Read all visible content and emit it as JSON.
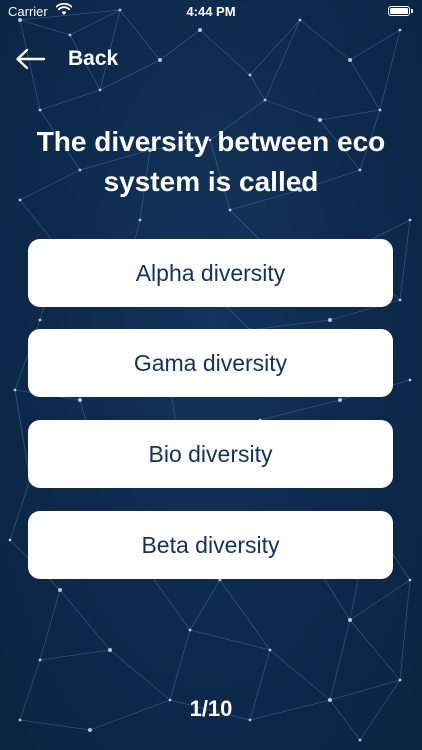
{
  "status_bar": {
    "carrier": "Carrier",
    "time": "4:44 PM",
    "wifi_icon": "wifi-icon",
    "battery_icon": "battery-icon"
  },
  "nav": {
    "back_label": "Back",
    "back_icon": "arrow-left-icon"
  },
  "question": {
    "text": "The diversity between eco system is called"
  },
  "options": [
    {
      "label": "Alpha diversity"
    },
    {
      "label": "Gama diversity"
    },
    {
      "label": "Bio diversity"
    },
    {
      "label": "Beta diversity"
    }
  ],
  "progress": {
    "text": "1/10"
  },
  "colors": {
    "background": "#0d2a4c",
    "option_background": "#ffffff",
    "option_text": "#123459",
    "network_lines": "#3f6a94"
  }
}
